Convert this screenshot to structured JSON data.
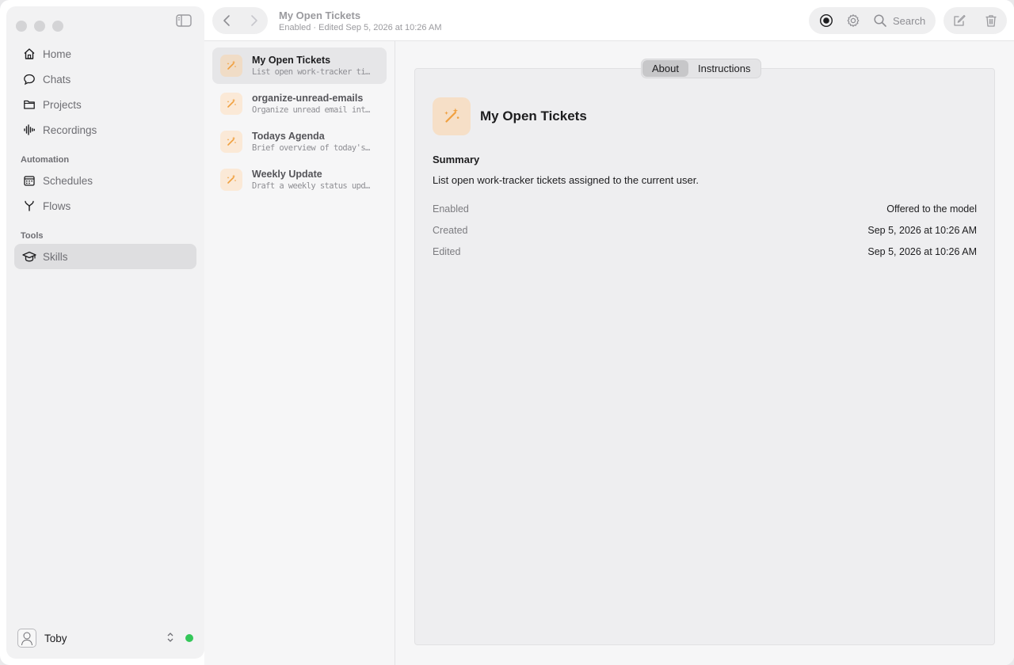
{
  "sidebar": {
    "nav": [
      {
        "label": "Home",
        "icon": "home-icon"
      },
      {
        "label": "Chats",
        "icon": "chat-icon"
      },
      {
        "label": "Projects",
        "icon": "folder-icon"
      },
      {
        "label": "Recordings",
        "icon": "waveform-icon"
      }
    ],
    "automation_label": "Automation",
    "automation": [
      {
        "label": "Schedules",
        "icon": "calendar-icon"
      },
      {
        "label": "Flows",
        "icon": "flow-icon"
      }
    ],
    "tools_label": "Tools",
    "tools": [
      {
        "label": "Skills",
        "icon": "graduation-cap-icon",
        "active": true
      }
    ],
    "user": {
      "name": "Toby",
      "status_color": "#34c759"
    }
  },
  "toolbar": {
    "title": "My Open Tickets",
    "subtitle": "Enabled · Edited Sep 5, 2026 at 10:26 AM",
    "search_label": "Search"
  },
  "list": {
    "items": [
      {
        "title": "My Open Tickets",
        "subtitle": "List open work-tracker tickets assigned to the current user.",
        "selected": true
      },
      {
        "title": "organize-unread-emails",
        "subtitle": "Organize unread email into useful groups.",
        "selected": false
      },
      {
        "title": "Todays Agenda",
        "subtitle": "Brief overview of today's calendar.",
        "selected": false
      },
      {
        "title": "Weekly Update",
        "subtitle": "Draft a weekly status update.",
        "selected": false
      }
    ]
  },
  "detail": {
    "tabs": [
      {
        "label": "About",
        "active": true
      },
      {
        "label": "Instructions",
        "active": false
      }
    ],
    "title": "My Open Tickets",
    "summary_heading": "Summary",
    "summary": "List open work-tracker tickets assigned to the current user.",
    "meta": [
      {
        "key": "Enabled",
        "value": "Offered to the model"
      },
      {
        "key": "Created",
        "value": "Sep 5, 2026 at 10:26 AM"
      },
      {
        "key": "Edited",
        "value": "Sep 5, 2026 at 10:26 AM"
      }
    ]
  },
  "colors": {
    "accent_icon": "#f0a040",
    "selected_bg": "#dedee0"
  }
}
